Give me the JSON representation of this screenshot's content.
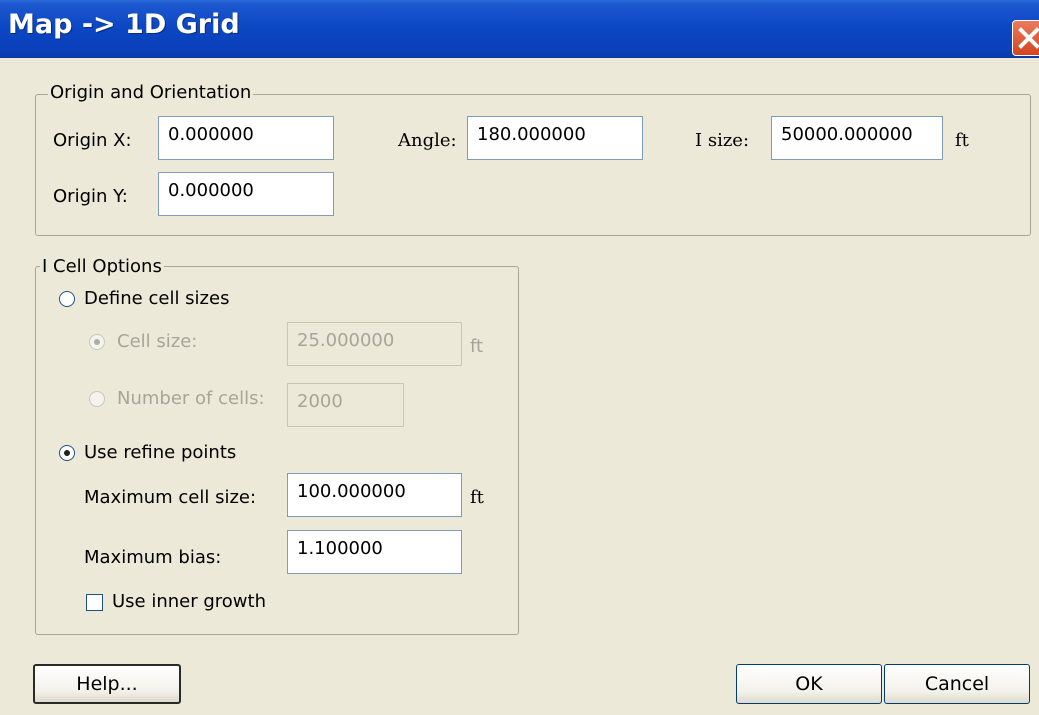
{
  "window": {
    "title": "Map -> 1D Grid"
  },
  "origin_group": {
    "legend": "Origin and Orientation",
    "origin_x_label": "Origin X:",
    "origin_x_value": "0.000000",
    "origin_y_label": "Origin Y:",
    "origin_y_value": "0.000000",
    "angle_label": "Angle:",
    "angle_value": "180.000000",
    "isize_label": "I size:",
    "isize_value": "50000.000000",
    "isize_unit": "ft"
  },
  "cell_options": {
    "legend": "I Cell Options",
    "define_cell_sizes": {
      "label": "Define cell sizes",
      "selected": false
    },
    "cell_size": {
      "label": "Cell size:",
      "value": "25.000000",
      "unit": "ft",
      "selected": true,
      "enabled": false
    },
    "number_of_cells": {
      "label": "Number of cells:",
      "value": "2000",
      "selected": false,
      "enabled": false
    },
    "use_refine_points": {
      "label": "Use refine points",
      "selected": true
    },
    "max_cell_size": {
      "label": "Maximum cell size:",
      "value": "100.000000",
      "unit": "ft"
    },
    "max_bias": {
      "label": "Maximum bias:",
      "value": "1.100000"
    },
    "inner_growth": {
      "label": "Use inner growth",
      "checked": false
    }
  },
  "buttons": {
    "help": "Help...",
    "ok": "OK",
    "cancel": "Cancel"
  },
  "colors": {
    "titlebar": "#0a46c3",
    "dialog_bg": "#ece9d8",
    "close_button": "#d4441f",
    "disabled_text": "#a7a59a"
  }
}
